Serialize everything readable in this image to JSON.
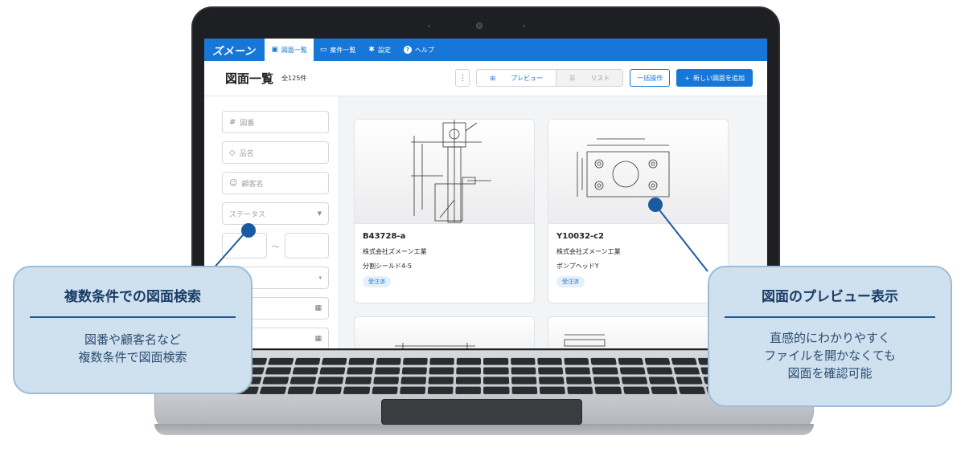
{
  "app": {
    "logo": "ズメーン",
    "nav": [
      {
        "icon": "▣",
        "label": "図面一覧",
        "active": true
      },
      {
        "icon": "▭",
        "label": "案件一覧",
        "active": false
      },
      {
        "icon": "✱",
        "label": "設定",
        "active": false
      },
      {
        "icon": "?",
        "label": "ヘルプ",
        "active": false
      }
    ]
  },
  "header": {
    "title": "図面一覧",
    "count": "全125件",
    "more": "⋮",
    "view_preview": "プレビュー",
    "view_list": "リスト",
    "bulk_action": "一括操作",
    "add_new": "新しい図面を追加",
    "add_icon": "+"
  },
  "filters": {
    "drawing_no": "図番",
    "product_name": "品名",
    "customer_name": "顧客名",
    "status": "ステータス",
    "range_sep": "〜"
  },
  "cards": [
    {
      "code": "B43728-a",
      "company": "株式会社ズメーン工業",
      "product": "分割シールド4-5",
      "status": "受注済"
    },
    {
      "code": "Y10032-c2",
      "company": "株式会社ズメーン工業",
      "product": "ポンプヘッドY",
      "status": "受注済"
    }
  ],
  "callouts": {
    "left": {
      "title": "複数条件での図面検索",
      "lines": [
        "図番や顧客名など",
        "複数条件で図面検索"
      ]
    },
    "right": {
      "title": "図面のプレビュー表示",
      "lines": [
        "直感的にわかりやすく",
        "ファイルを開かなくても",
        "図面を確認可能"
      ]
    }
  },
  "colors": {
    "primary": "#1677d8",
    "callout_bg": "#cfe0ef",
    "callout_accent": "#1a5aa0"
  }
}
